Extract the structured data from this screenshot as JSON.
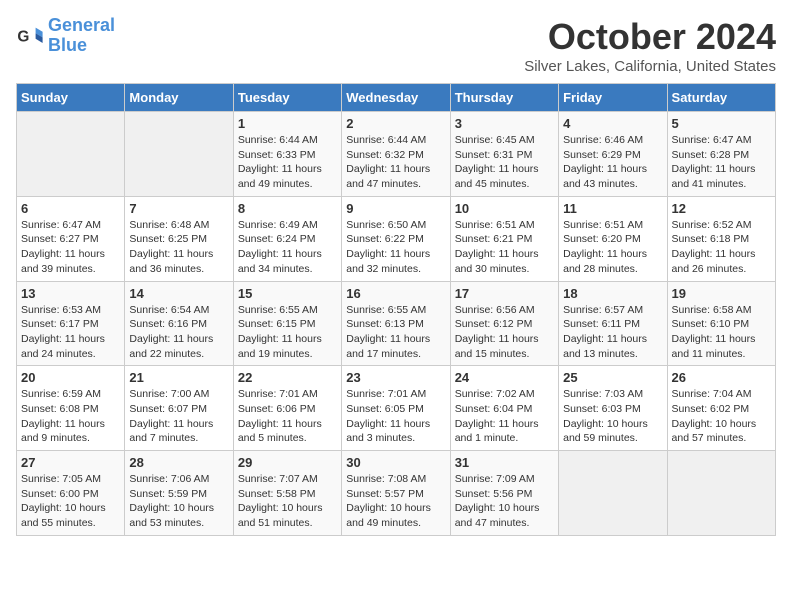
{
  "logo": {
    "line1": "General",
    "line2": "Blue"
  },
  "title": "October 2024",
  "location": "Silver Lakes, California, United States",
  "days_of_week": [
    "Sunday",
    "Monday",
    "Tuesday",
    "Wednesday",
    "Thursday",
    "Friday",
    "Saturday"
  ],
  "weeks": [
    [
      {
        "day": "",
        "info": ""
      },
      {
        "day": "",
        "info": ""
      },
      {
        "day": "1",
        "info": "Sunrise: 6:44 AM\nSunset: 6:33 PM\nDaylight: 11 hours and 49 minutes."
      },
      {
        "day": "2",
        "info": "Sunrise: 6:44 AM\nSunset: 6:32 PM\nDaylight: 11 hours and 47 minutes."
      },
      {
        "day": "3",
        "info": "Sunrise: 6:45 AM\nSunset: 6:31 PM\nDaylight: 11 hours and 45 minutes."
      },
      {
        "day": "4",
        "info": "Sunrise: 6:46 AM\nSunset: 6:29 PM\nDaylight: 11 hours and 43 minutes."
      },
      {
        "day": "5",
        "info": "Sunrise: 6:47 AM\nSunset: 6:28 PM\nDaylight: 11 hours and 41 minutes."
      }
    ],
    [
      {
        "day": "6",
        "info": "Sunrise: 6:47 AM\nSunset: 6:27 PM\nDaylight: 11 hours and 39 minutes."
      },
      {
        "day": "7",
        "info": "Sunrise: 6:48 AM\nSunset: 6:25 PM\nDaylight: 11 hours and 36 minutes."
      },
      {
        "day": "8",
        "info": "Sunrise: 6:49 AM\nSunset: 6:24 PM\nDaylight: 11 hours and 34 minutes."
      },
      {
        "day": "9",
        "info": "Sunrise: 6:50 AM\nSunset: 6:22 PM\nDaylight: 11 hours and 32 minutes."
      },
      {
        "day": "10",
        "info": "Sunrise: 6:51 AM\nSunset: 6:21 PM\nDaylight: 11 hours and 30 minutes."
      },
      {
        "day": "11",
        "info": "Sunrise: 6:51 AM\nSunset: 6:20 PM\nDaylight: 11 hours and 28 minutes."
      },
      {
        "day": "12",
        "info": "Sunrise: 6:52 AM\nSunset: 6:18 PM\nDaylight: 11 hours and 26 minutes."
      }
    ],
    [
      {
        "day": "13",
        "info": "Sunrise: 6:53 AM\nSunset: 6:17 PM\nDaylight: 11 hours and 24 minutes."
      },
      {
        "day": "14",
        "info": "Sunrise: 6:54 AM\nSunset: 6:16 PM\nDaylight: 11 hours and 22 minutes."
      },
      {
        "day": "15",
        "info": "Sunrise: 6:55 AM\nSunset: 6:15 PM\nDaylight: 11 hours and 19 minutes."
      },
      {
        "day": "16",
        "info": "Sunrise: 6:55 AM\nSunset: 6:13 PM\nDaylight: 11 hours and 17 minutes."
      },
      {
        "day": "17",
        "info": "Sunrise: 6:56 AM\nSunset: 6:12 PM\nDaylight: 11 hours and 15 minutes."
      },
      {
        "day": "18",
        "info": "Sunrise: 6:57 AM\nSunset: 6:11 PM\nDaylight: 11 hours and 13 minutes."
      },
      {
        "day": "19",
        "info": "Sunrise: 6:58 AM\nSunset: 6:10 PM\nDaylight: 11 hours and 11 minutes."
      }
    ],
    [
      {
        "day": "20",
        "info": "Sunrise: 6:59 AM\nSunset: 6:08 PM\nDaylight: 11 hours and 9 minutes."
      },
      {
        "day": "21",
        "info": "Sunrise: 7:00 AM\nSunset: 6:07 PM\nDaylight: 11 hours and 7 minutes."
      },
      {
        "day": "22",
        "info": "Sunrise: 7:01 AM\nSunset: 6:06 PM\nDaylight: 11 hours and 5 minutes."
      },
      {
        "day": "23",
        "info": "Sunrise: 7:01 AM\nSunset: 6:05 PM\nDaylight: 11 hours and 3 minutes."
      },
      {
        "day": "24",
        "info": "Sunrise: 7:02 AM\nSunset: 6:04 PM\nDaylight: 11 hours and 1 minute."
      },
      {
        "day": "25",
        "info": "Sunrise: 7:03 AM\nSunset: 6:03 PM\nDaylight: 10 hours and 59 minutes."
      },
      {
        "day": "26",
        "info": "Sunrise: 7:04 AM\nSunset: 6:02 PM\nDaylight: 10 hours and 57 minutes."
      }
    ],
    [
      {
        "day": "27",
        "info": "Sunrise: 7:05 AM\nSunset: 6:00 PM\nDaylight: 10 hours and 55 minutes."
      },
      {
        "day": "28",
        "info": "Sunrise: 7:06 AM\nSunset: 5:59 PM\nDaylight: 10 hours and 53 minutes."
      },
      {
        "day": "29",
        "info": "Sunrise: 7:07 AM\nSunset: 5:58 PM\nDaylight: 10 hours and 51 minutes."
      },
      {
        "day": "30",
        "info": "Sunrise: 7:08 AM\nSunset: 5:57 PM\nDaylight: 10 hours and 49 minutes."
      },
      {
        "day": "31",
        "info": "Sunrise: 7:09 AM\nSunset: 5:56 PM\nDaylight: 10 hours and 47 minutes."
      },
      {
        "day": "",
        "info": ""
      },
      {
        "day": "",
        "info": ""
      }
    ]
  ]
}
